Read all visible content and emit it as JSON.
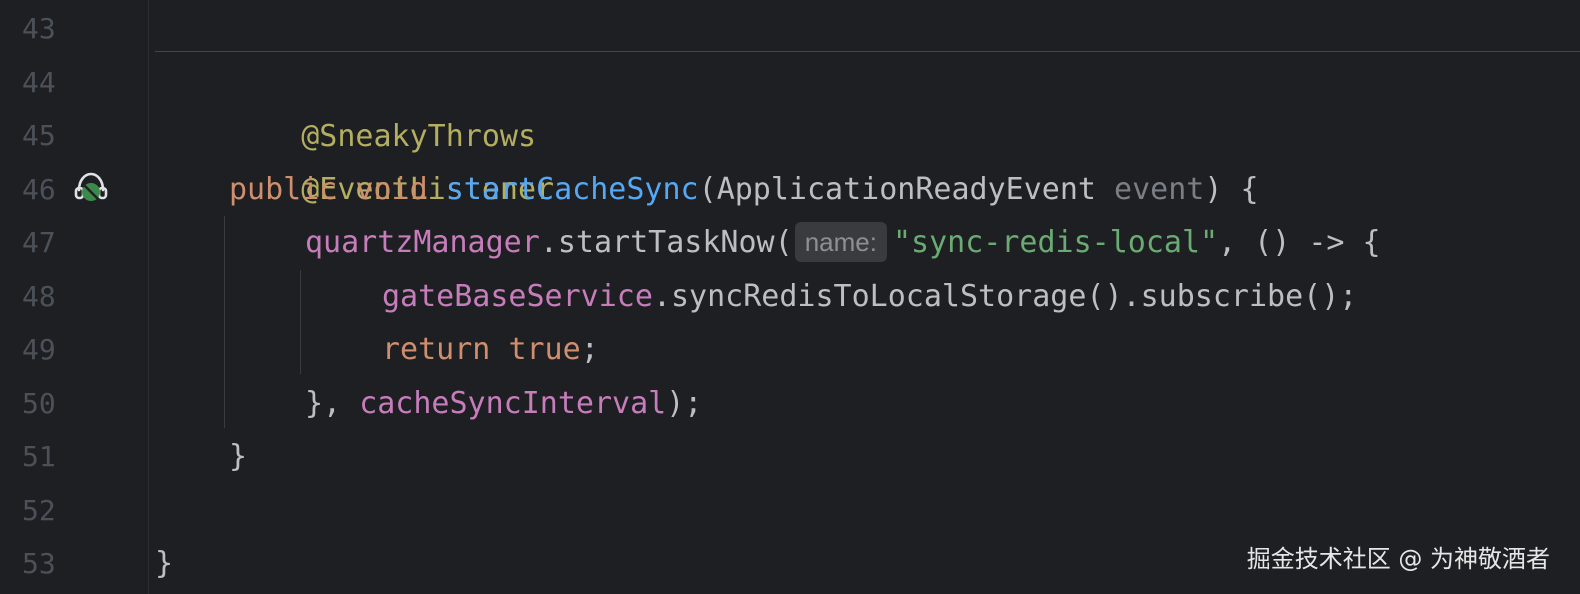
{
  "gutter": {
    "line_numbers": [
      "43",
      "44",
      "45",
      "46",
      "47",
      "48",
      "49",
      "50",
      "51",
      "52",
      "53"
    ],
    "run_icon": "no-coverage-icon"
  },
  "code": {
    "l44": {
      "annotation": "@SneakyThrows"
    },
    "l45": {
      "annotation": "@EventListener"
    },
    "l46": {
      "kw_public": "public",
      "kw_void": "void",
      "method": "startCacheSync",
      "open_paren": "(",
      "param_type": "ApplicationReadyEvent",
      "param_name": "event",
      "close": ") {"
    },
    "l47": {
      "field": "quartzManager",
      "call": ".startTaskNow(",
      "hint": "name:",
      "string": "\"sync-redis-local\"",
      "rest": ", () -> {"
    },
    "l48": {
      "field": "gateBaseService",
      "call": ".syncRedisToLocalStorage().subscribe();"
    },
    "l49": {
      "kw_return": "return",
      "kw_true": "true",
      "semicolon": ";"
    },
    "l50": {
      "open": "}, ",
      "field": "cacheSyncInterval",
      "close": ");"
    },
    "l51": {
      "brace": "}"
    },
    "l53": {
      "brace": "}"
    }
  },
  "watermark": "掘金技术社区 @ 为神敬酒者"
}
